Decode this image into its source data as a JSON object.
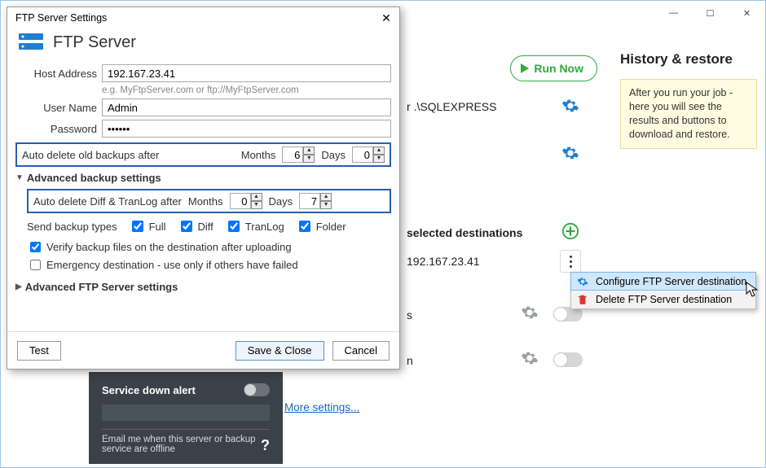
{
  "window": {
    "minimize": "—",
    "maximize": "☐",
    "close": "✕"
  },
  "runnow": "Run Now",
  "mid": {
    "sqlexpress": "r .\\SQLEXPRESS",
    "seldest": "selected destinations",
    "ftpip": "192.167.23.41",
    "s": "s",
    "n": "n",
    "more": "More settings..."
  },
  "history": {
    "title": "History & restore",
    "hint": "After you run your job - here you will see the results and buttons to download and restore."
  },
  "darkpanel": {
    "title": "Service down alert",
    "sub": "Email me when this server or backup service are offline",
    "q": "?"
  },
  "ctx": {
    "configure": "Configure FTP Server destination",
    "delete": "Delete FTP Server destination"
  },
  "dialog": {
    "title": "FTP Server Settings",
    "header": "FTP Server",
    "host_label": "Host Address",
    "host_value": "192.167.23.41",
    "host_hint": "e.g. MyFtpServer.com or ftp://MyFtpServer.com",
    "user_label": "User Name",
    "user_value": "Admin",
    "pass_label": "Password",
    "pass_value": "••••••",
    "auto_del": "Auto delete old backups after",
    "months": "Months",
    "days": "Days",
    "m_val": "6",
    "d_val": "0",
    "adv_backup": "Advanced backup settings",
    "auto_del_diff": "Auto delete Diff & TranLog after",
    "m2_val": "0",
    "d2_val": "7",
    "send_types": "Send backup types",
    "full": "Full",
    "diff": "Diff",
    "tranlog": "TranLog",
    "folder": "Folder",
    "verify": "Verify backup files on the destination after uploading",
    "emergency": "Emergency destination - use only if others have failed",
    "adv_ftp": "Advanced FTP Server settings",
    "test": "Test",
    "save": "Save & Close",
    "cancel": "Cancel"
  }
}
